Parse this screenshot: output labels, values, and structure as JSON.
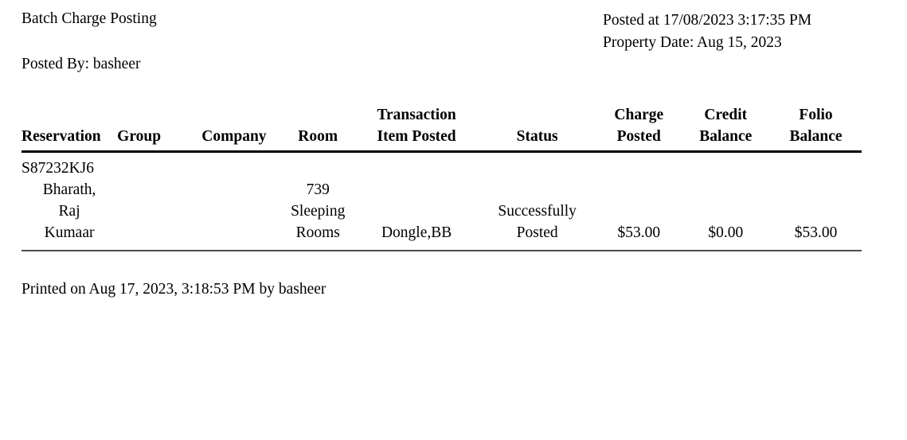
{
  "document": {
    "title": "Batch Charge Posting",
    "posted_by": "Posted By: basheer",
    "posted_at": "Posted at 17/08/2023 3:17:35 PM",
    "property_date": "Property Date: Aug 15, 2023",
    "footer": "Printed on Aug 17, 2023, 3:18:53 PM by basheer"
  },
  "table": {
    "headers": {
      "reservation": "Reservation",
      "group": "Group",
      "company": "Company",
      "room": "Room",
      "transaction_item_posted_line1": "Transaction",
      "transaction_item_posted_line2": "Item Posted",
      "status": "Status",
      "charge_posted_line1": "Charge",
      "charge_posted_line2": "Posted",
      "credit_balance_line1": "Credit",
      "credit_balance_line2": "Balance",
      "folio_balance_line1": "Folio",
      "folio_balance_line2": "Balance"
    },
    "rows": [
      {
        "reservation_line1": "S87232KJ6",
        "reservation_line2": "Bharath,",
        "reservation_line3": "Raj",
        "reservation_line4": "Kumaar",
        "group": "",
        "company": "",
        "room_line1": "739",
        "room_line2": "Sleeping",
        "room_line3": "Rooms",
        "transaction_item_posted": "Dongle,BB",
        "status_line1": "Successfully",
        "status_line2": "Posted",
        "charge_posted": "$53.00",
        "credit_balance": "$0.00",
        "folio_balance": "$53.00"
      }
    ]
  },
  "colors": {
    "text": "#000000",
    "background": "#ffffff",
    "header_rule": "#000000",
    "row_rule": "#4d4d4d"
  }
}
